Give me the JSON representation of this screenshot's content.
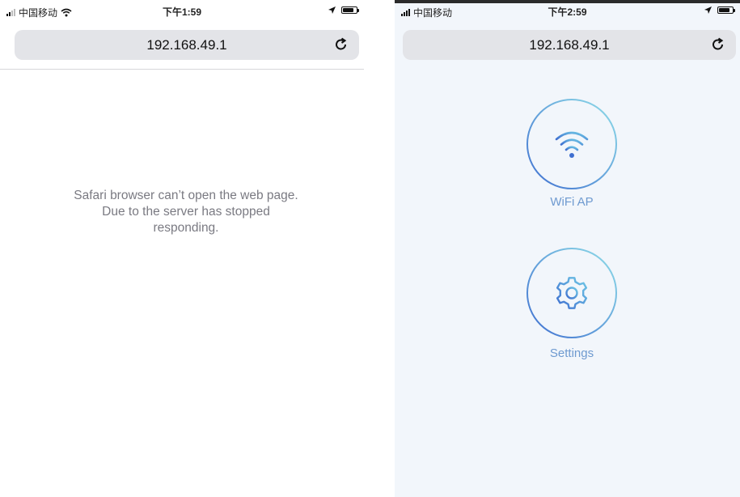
{
  "left_screen": {
    "status_bar": {
      "carrier": "中国移动",
      "time": "下午1:59",
      "battery_fraction": 0.7
    },
    "url_bar": {
      "url": "192.168.49.1"
    },
    "error_message": {
      "line1": "Safari browser can’t open the web page.",
      "line2": "Due to the server has stopped",
      "line3": "responding."
    }
  },
  "right_screen": {
    "status_bar": {
      "carrier": "中国移动",
      "time": "下午2:59",
      "battery_fraction": 0.7
    },
    "url_bar": {
      "url": "192.168.49.1"
    },
    "menu": {
      "items": [
        {
          "label": "WiFi AP",
          "icon": "wifi-icon"
        },
        {
          "label": "Settings",
          "icon": "gear-icon"
        }
      ]
    }
  },
  "colors": {
    "accent_blue": "#4f86d6",
    "accent_teal": "#7fd3e0",
    "label_blue": "#6e9ad0",
    "url_bar_bg": "#e3e4e8",
    "right_bg": "#f2f6fb"
  }
}
